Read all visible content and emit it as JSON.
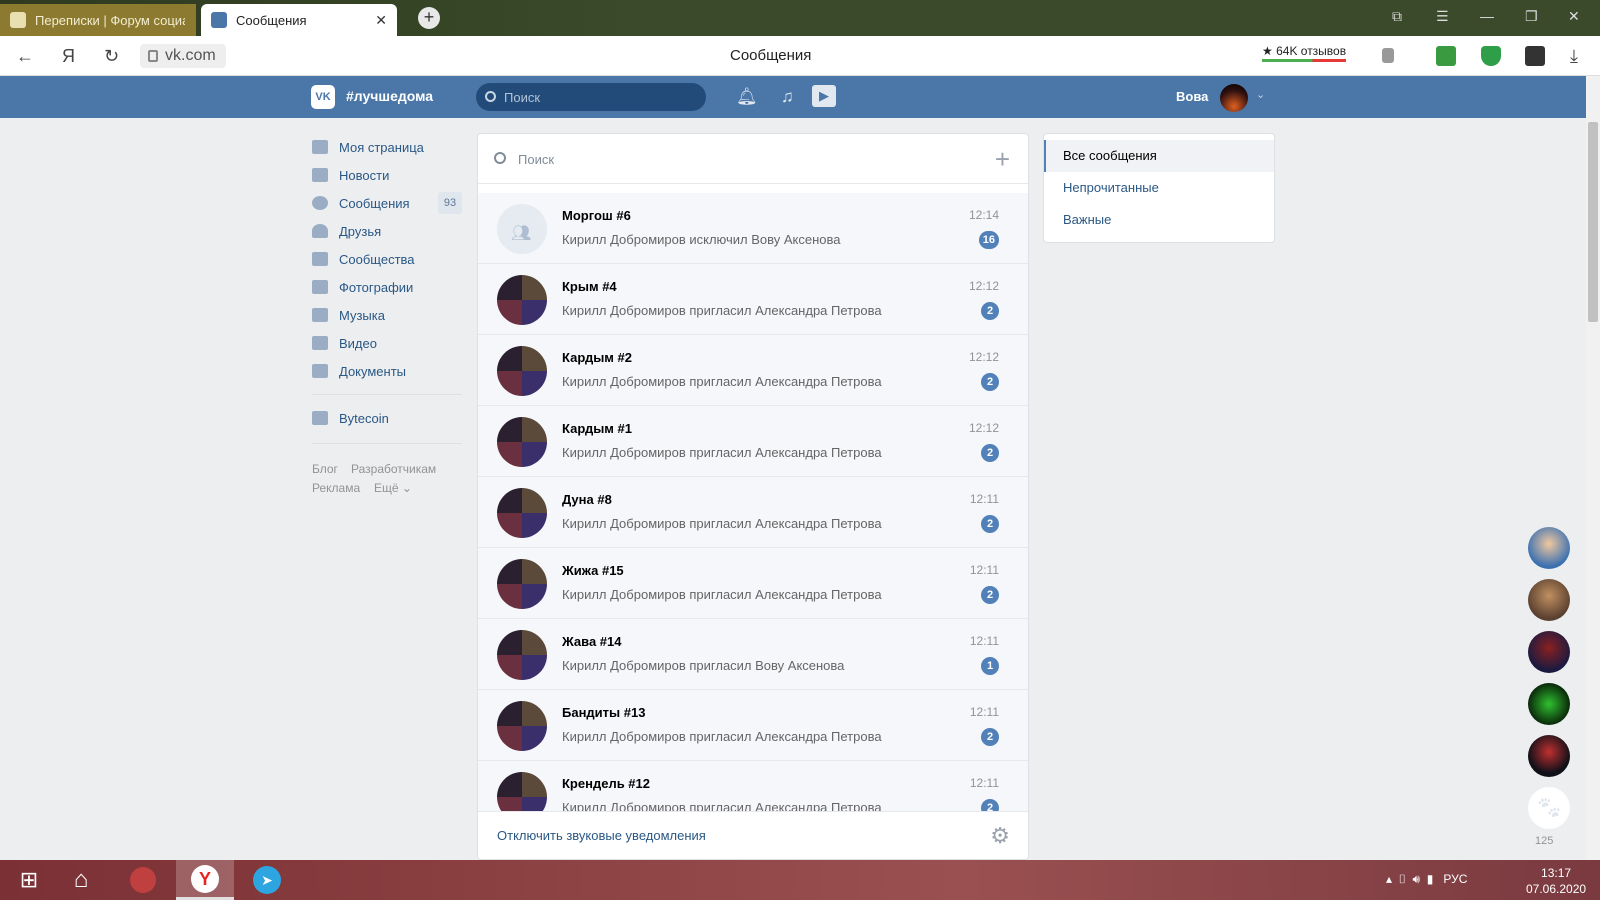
{
  "browser": {
    "tabs": [
      {
        "label": "Переписки | Форум социа"
      },
      {
        "label": "Сообщения",
        "close": "✕"
      }
    ],
    "new_tab": "+",
    "url": "vk.com",
    "page_title": "Сообщения",
    "reviews": "★ 64K отзывов"
  },
  "vk_header": {
    "brand": "#лучшедома",
    "search_placeholder": "Поиск",
    "user_name": "Вова"
  },
  "left_menu": {
    "items": [
      {
        "label": "Моя страница"
      },
      {
        "label": "Новости"
      },
      {
        "label": "Сообщения",
        "count": "93"
      },
      {
        "label": "Друзья"
      },
      {
        "label": "Сообщества"
      },
      {
        "label": "Фотографии"
      },
      {
        "label": "Музыка"
      },
      {
        "label": "Видео"
      },
      {
        "label": "Документы"
      }
    ],
    "extra": {
      "label": "Bytecoin"
    },
    "footer": [
      "Блог",
      "Разработчикам",
      "Реклама",
      "Ещё ⌄"
    ]
  },
  "dialogs": {
    "search_placeholder": "Поиск",
    "list": [
      {
        "name": "Моргош #6",
        "message": "Кирилл Добромиров исключил Вову Аксенова",
        "time": "12:14",
        "unread": "16"
      },
      {
        "name": "Крым #4",
        "message": "Кирилл Добромиров пригласил Александра Петрова",
        "time": "12:12",
        "unread": "2"
      },
      {
        "name": "Кардым #2",
        "message": "Кирилл Добромиров пригласил Александра Петрова",
        "time": "12:12",
        "unread": "2"
      },
      {
        "name": "Кардым #1",
        "message": "Кирилл Добромиров пригласил Александра Петрова",
        "time": "12:12",
        "unread": "2"
      },
      {
        "name": "Дуна #8",
        "message": "Кирилл Добромиров пригласил Александра Петрова",
        "time": "12:11",
        "unread": "2"
      },
      {
        "name": "Жижа #15",
        "message": "Кирилл Добромиров пригласил Александра Петрова",
        "time": "12:11",
        "unread": "2"
      },
      {
        "name": "Жава #14",
        "message": "Кирилл Добромиров пригласил Вову Аксенова",
        "time": "12:11",
        "unread": "1"
      },
      {
        "name": "Бандиты #13",
        "message": "Кирилл Добромиров пригласил Александра Петрова",
        "time": "12:11",
        "unread": "2"
      },
      {
        "name": "Крендель #12",
        "message": "Кирилл Добромиров пригласил Александра Петрова",
        "time": "12:11",
        "unread": "2"
      }
    ],
    "footer_link": "Отключить звуковые уведомления"
  },
  "filters": {
    "items": [
      {
        "label": "Все сообщения"
      },
      {
        "label": "Непрочитанные"
      },
      {
        "label": "Важные"
      }
    ]
  },
  "right_chats": {
    "count": "125"
  },
  "taskbar": {
    "tray_lang": "РУС",
    "time": "13:17",
    "date": "07.06.2020"
  },
  "colors": {
    "vk_blue": "#4a76a8",
    "link": "#2a5885",
    "badge": "#5181b8",
    "bg": "#edeef0"
  }
}
